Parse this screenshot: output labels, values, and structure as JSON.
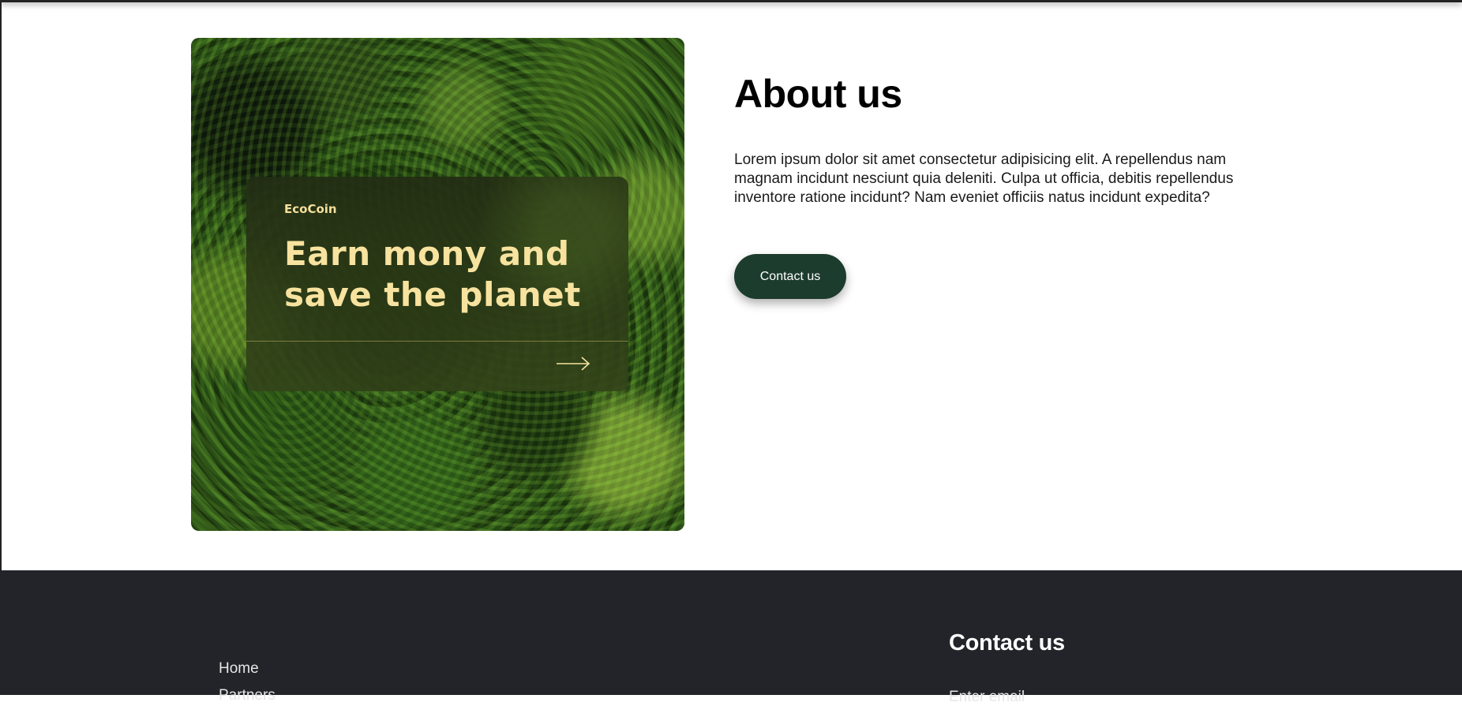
{
  "promo": {
    "brand": "EcoCoin",
    "headline": "Earn mony and save the planet",
    "arrow_icon": "arrow-right-icon",
    "text_color": "#f7e39f"
  },
  "about": {
    "title": "About us",
    "body": "Lorem ipsum dolor sit amet consectetur adipisicing elit. A repellendus nam magnam incidunt nesciunt quia deleniti. Culpa ut officia, debitis repellendus inventore ratione incidunt? Nam eveniet officiis natus incidunt expedita?",
    "contact_button": "Contact us",
    "button_color": "#1c3c2e"
  },
  "footer": {
    "background": "#232429",
    "nav": [
      "Home",
      "Partners"
    ],
    "contact_title": "Contact us",
    "email_label": "Enter email"
  }
}
